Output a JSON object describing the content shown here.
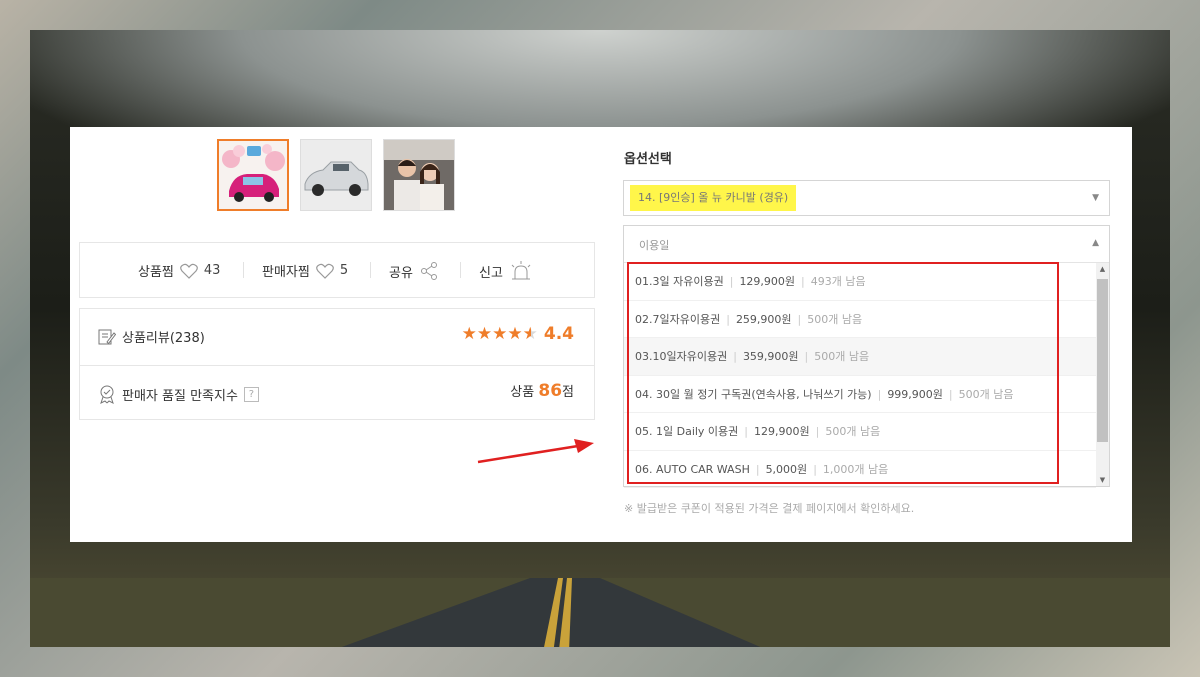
{
  "product": {
    "thumbnails": [
      {
        "name": "thumb-pink-car",
        "active": true
      },
      {
        "name": "thumb-silver-sedan",
        "active": false
      },
      {
        "name": "thumb-couple-in-car",
        "active": false
      }
    ]
  },
  "stats": {
    "wish_label": "상품찜",
    "wish_count": "43",
    "seller_label": "판매자찜",
    "seller_count": "5",
    "share_label": "공유",
    "report_label": "신고"
  },
  "reviews": {
    "label": "상품리뷰(238)",
    "rating": "4.4",
    "stars_filled": 4,
    "stars_half": true,
    "quality_label": "판매자 품질 만족지수",
    "quality_help": "?",
    "quality_prefix": "상품",
    "quality_score": "86",
    "quality_suffix": "점"
  },
  "options": {
    "title": "옵션선택",
    "selected": "14. [9인승] 올 뉴 카니발 (경유)",
    "date_placeholder": "이용일",
    "items": [
      {
        "name": "01.3일 자유이용권",
        "price": "129,900원",
        "remain": "493개 남음"
      },
      {
        "name": "02.7일자유이용권",
        "price": "259,900원",
        "remain": "500개 남음"
      },
      {
        "name": "03.10일자유이용권",
        "price": "359,900원",
        "remain": "500개 남음"
      },
      {
        "name": "04. 30일 월 정기 구독권(연속사용, 나눠쓰기 가능)",
        "price": "999,900원",
        "remain": "500개 남음"
      },
      {
        "name": "05. 1일 Daily 이용권",
        "price": "129,900원",
        "remain": "500개 남음"
      },
      {
        "name": "06. AUTO CAR WASH",
        "price": "5,000원",
        "remain": "1,000개 남음"
      }
    ],
    "notice": "※ 발급받은 쿠폰이 적용된 가격은 결제 페이지에서 확인하세요."
  },
  "colors": {
    "accent": "#ef7d2a",
    "highlight_box": "#e02020",
    "selected_highlight": "#fff64a"
  }
}
